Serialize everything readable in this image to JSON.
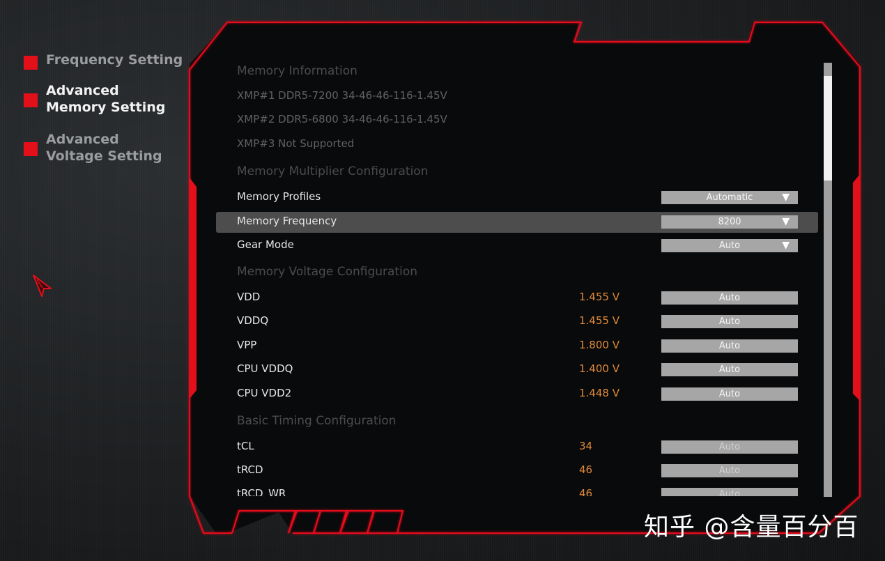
{
  "sidebar": {
    "items": [
      {
        "label": "Frequency Setting",
        "active": false
      },
      {
        "label": "Advanced Memory Setting",
        "active": true
      },
      {
        "label": "Advanced Voltage Setting",
        "active": false
      }
    ]
  },
  "colors": {
    "accent": "#e3101a",
    "value": "#e08a3a",
    "control_bg": "#a6a6a6",
    "selected_row": "#4d4d4d"
  },
  "content": {
    "memory_info": {
      "header": "Memory Information",
      "xmp1": "XMP#1 DDR5-7200 34-46-46-116-1.45V",
      "xmp2": "XMP#2 DDR5-6800 34-46-46-116-1.45V",
      "xmp3": "XMP#3 Not Supported"
    },
    "multiplier": {
      "header": "Memory Multiplier Configuration",
      "memory_profiles": {
        "label": "Memory Profiles",
        "value": "Automatic",
        "icon": "triangle-down-icon"
      },
      "memory_frequency": {
        "label": "Memory Frequency",
        "value": "8200",
        "icon": "triangle-down-icon"
      },
      "gear_mode": {
        "label": "Gear Mode",
        "value": "Auto",
        "icon": "triangle-down-icon"
      }
    },
    "voltage": {
      "header": "Memory Voltage Configuration",
      "rows": [
        {
          "label": "VDD",
          "current": "1.455 V",
          "setting": "Auto"
        },
        {
          "label": "VDDQ",
          "current": "1.455 V",
          "setting": "Auto"
        },
        {
          "label": "VPP",
          "current": "1.800 V",
          "setting": "Auto"
        },
        {
          "label": "CPU VDDQ",
          "current": "1.400 V",
          "setting": "Auto"
        },
        {
          "label": "CPU VDD2",
          "current": "1.448 V",
          "setting": "Auto"
        }
      ]
    },
    "timing": {
      "header": "Basic Timing Configuration",
      "rows": [
        {
          "label": "tCL",
          "current": "34",
          "setting": "Auto"
        },
        {
          "label": "tRCD",
          "current": "46",
          "setting": "Auto"
        },
        {
          "label": "tRCD_WR",
          "current": "46",
          "setting": "Auto"
        }
      ]
    }
  },
  "scrollbar": {
    "position_fraction": 0.03,
    "visible_fraction": 0.24
  },
  "watermark": "知乎 @含量百分百"
}
